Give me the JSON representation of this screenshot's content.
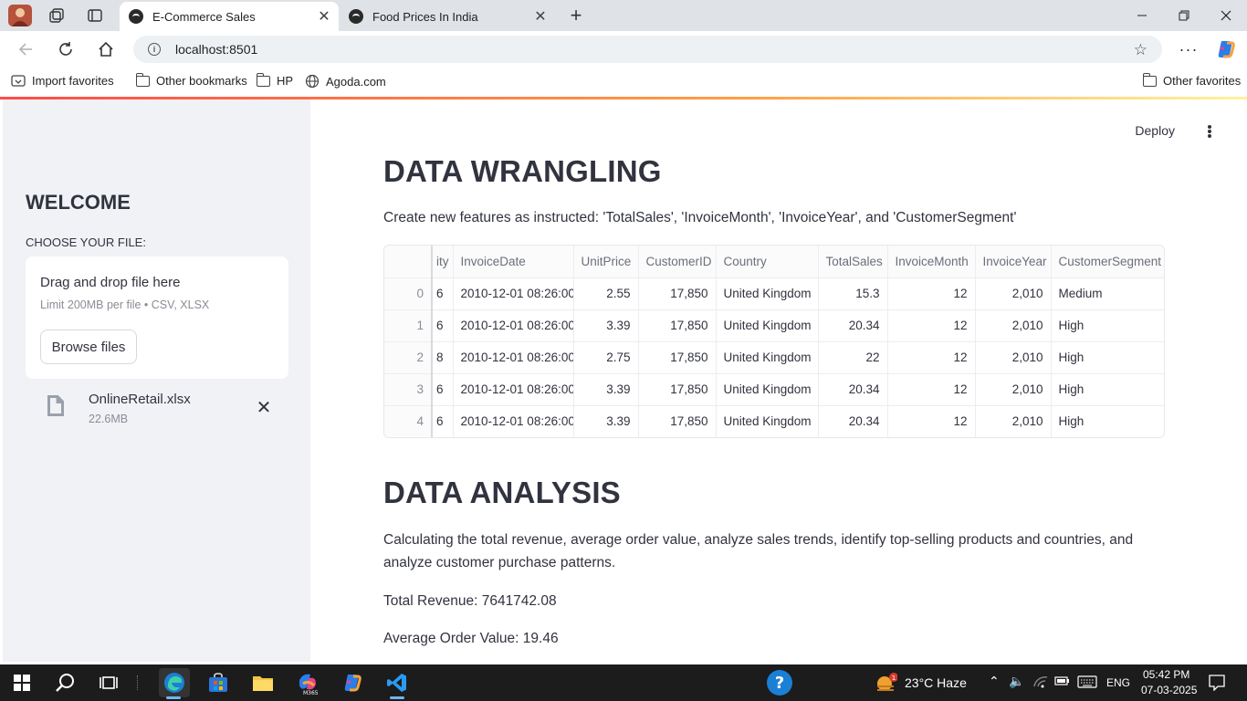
{
  "browser": {
    "tabs": [
      {
        "title": "E-Commerce Sales",
        "active": true
      },
      {
        "title": "Food Prices In India",
        "active": false
      }
    ],
    "url": "localhost:8501",
    "bookmarks": [
      "Import favorites",
      "Other bookmarks",
      "HP",
      "Agoda.com"
    ],
    "other_favorites": "Other favorites"
  },
  "sidebar": {
    "title": "WELCOME",
    "choose_label": "CHOOSE YOUR FILE:",
    "dropzone_text": "Drag and drop file here",
    "dropzone_limit": "Limit 200MB per file • CSV, XLSX",
    "browse_label": "Browse files",
    "file": {
      "name": "OnlineRetail.xlsx",
      "size": "22.6MB"
    }
  },
  "header": {
    "deploy_label": "Deploy"
  },
  "main": {
    "section1_title": "DATA WRANGLING",
    "section1_desc": "Create new features as instructed: 'TotalSales', 'InvoiceMonth', 'InvoiceYear', and 'CustomerSegment'",
    "table": {
      "columns": [
        "",
        "ity",
        "InvoiceDate",
        "UnitPrice",
        "CustomerID",
        "Country",
        "TotalSales",
        "InvoiceMonth",
        "InvoiceYear",
        "CustomerSegment"
      ],
      "rows": [
        [
          "0",
          "6",
          "2010-12-01 08:26:00",
          "2.55",
          "17,850",
          "United Kingdom",
          "15.3",
          "12",
          "2,010",
          "Medium"
        ],
        [
          "1",
          "6",
          "2010-12-01 08:26:00",
          "3.39",
          "17,850",
          "United Kingdom",
          "20.34",
          "12",
          "2,010",
          "High"
        ],
        [
          "2",
          "8",
          "2010-12-01 08:26:00",
          "2.75",
          "17,850",
          "United Kingdom",
          "22",
          "12",
          "2,010",
          "High"
        ],
        [
          "3",
          "6",
          "2010-12-01 08:26:00",
          "3.39",
          "17,850",
          "United Kingdom",
          "20.34",
          "12",
          "2,010",
          "High"
        ],
        [
          "4",
          "6",
          "2010-12-01 08:26:00",
          "3.39",
          "17,850",
          "United Kingdom",
          "20.34",
          "12",
          "2,010",
          "High"
        ]
      ]
    },
    "section2_title": "DATA ANALYSIS",
    "section2_desc": "Calculating the total revenue, average order value, analyze sales trends, identify top-selling products and countries, and analyze customer purchase patterns.",
    "total_revenue": "Total Revenue: 7641742.08",
    "avg_order_value": "Average Order Value: 19.46"
  },
  "taskbar": {
    "weather": "23°C  Haze",
    "weather_badge": "1",
    "lang": "ENG",
    "time": "05:42 PM",
    "date": "07-03-2025"
  },
  "colors": {
    "accent_red": "#ff4b4b",
    "sidebar_bg": "#f0f2f6",
    "text": "#31333f",
    "edge_blue": "#1b7fd6",
    "vscode_blue": "#2b9af3"
  }
}
